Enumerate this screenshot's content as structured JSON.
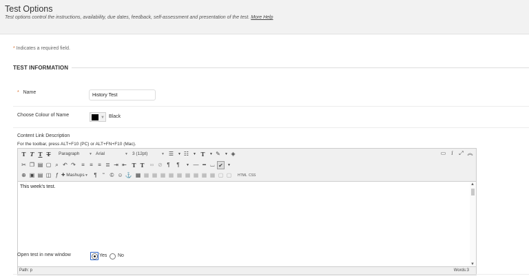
{
  "header": {
    "title": "Test Options",
    "subtitle": "Test options control the instructions, availability, due dates, feedback, self-assessment and presentation of the test.",
    "help_link": "More Help"
  },
  "required_note": {
    "star": "*",
    "text": "Indicates a required field."
  },
  "section": {
    "title": "TEST INFORMATION"
  },
  "name_field": {
    "star": "*",
    "label": "Name",
    "value": "History Test"
  },
  "colour_field": {
    "label": "Choose Colour of Name",
    "selected_color": "#000000",
    "selected_name": "Black"
  },
  "description_field": {
    "label": "Content Link Description",
    "toolbar_help": "For the toolbar, press ALT+F10 (PC) or ALT+FN+F10 (Mac)."
  },
  "editor": {
    "toolbar": {
      "format_select": "Paragraph",
      "font_select": "Arial",
      "size_select": "3 (12pt)",
      "mashups_label": "Mashups",
      "html_label": "HTML",
      "css_label": "CSS"
    },
    "content": "This week's test.",
    "path": "Path: p",
    "words": "Words:3"
  },
  "new_window_field": {
    "label": "Open test in new window",
    "options": [
      {
        "label": "Yes",
        "selected": true
      },
      {
        "label": "No",
        "selected": false
      }
    ]
  }
}
